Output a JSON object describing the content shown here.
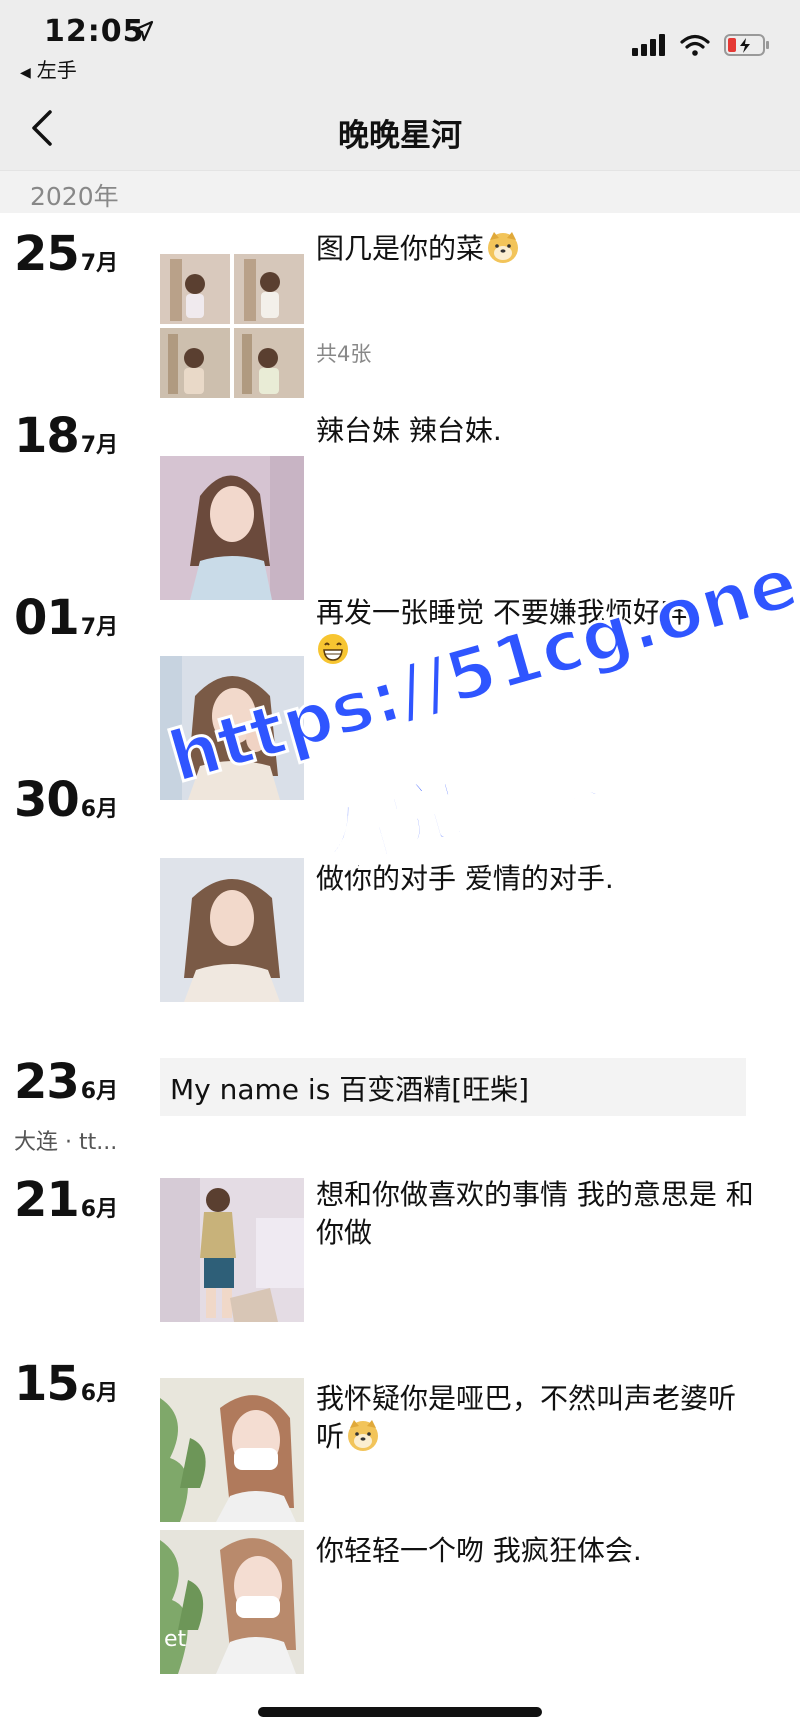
{
  "status_bar": {
    "time": "12:05",
    "back_app": "左手"
  },
  "nav": {
    "title": "晚晚星河"
  },
  "year": "2020年",
  "posts": [
    {
      "day": "25",
      "month": "7月",
      "text": "图几是你的菜",
      "emoji": "doge-emoji",
      "count": "共4张"
    },
    {
      "day": "18",
      "month": "7月",
      "text": "辣台妹 辣台妹."
    },
    {
      "day": "01",
      "month": "7月",
      "text": "再发一张睡觉 不要嫌我烦好咩",
      "emoji": "grin-emoji"
    },
    {
      "day": "30",
      "month": "6月",
      "text": "做你的对手 爱情的对手."
    },
    {
      "day": "23",
      "month": "6月",
      "text": "My name is 百变酒精[旺柴]",
      "location": "大连 · tt..."
    },
    {
      "day": "21",
      "month": "6月",
      "text": "想和你做喜欢的事情 我的意思是 和你做"
    },
    {
      "day": "15",
      "month": "6月",
      "text": "我怀疑你是哑巴，不然叫声老婆听听",
      "emoji": "doge-emoji",
      "text2": "你轻轻一个吻 我疯狂体会.",
      "thumb_caption": "et"
    }
  ],
  "watermark": {
    "line1": "https://51cg.one",
    "line2": "看完整版",
    "color": "#2f55ff"
  }
}
